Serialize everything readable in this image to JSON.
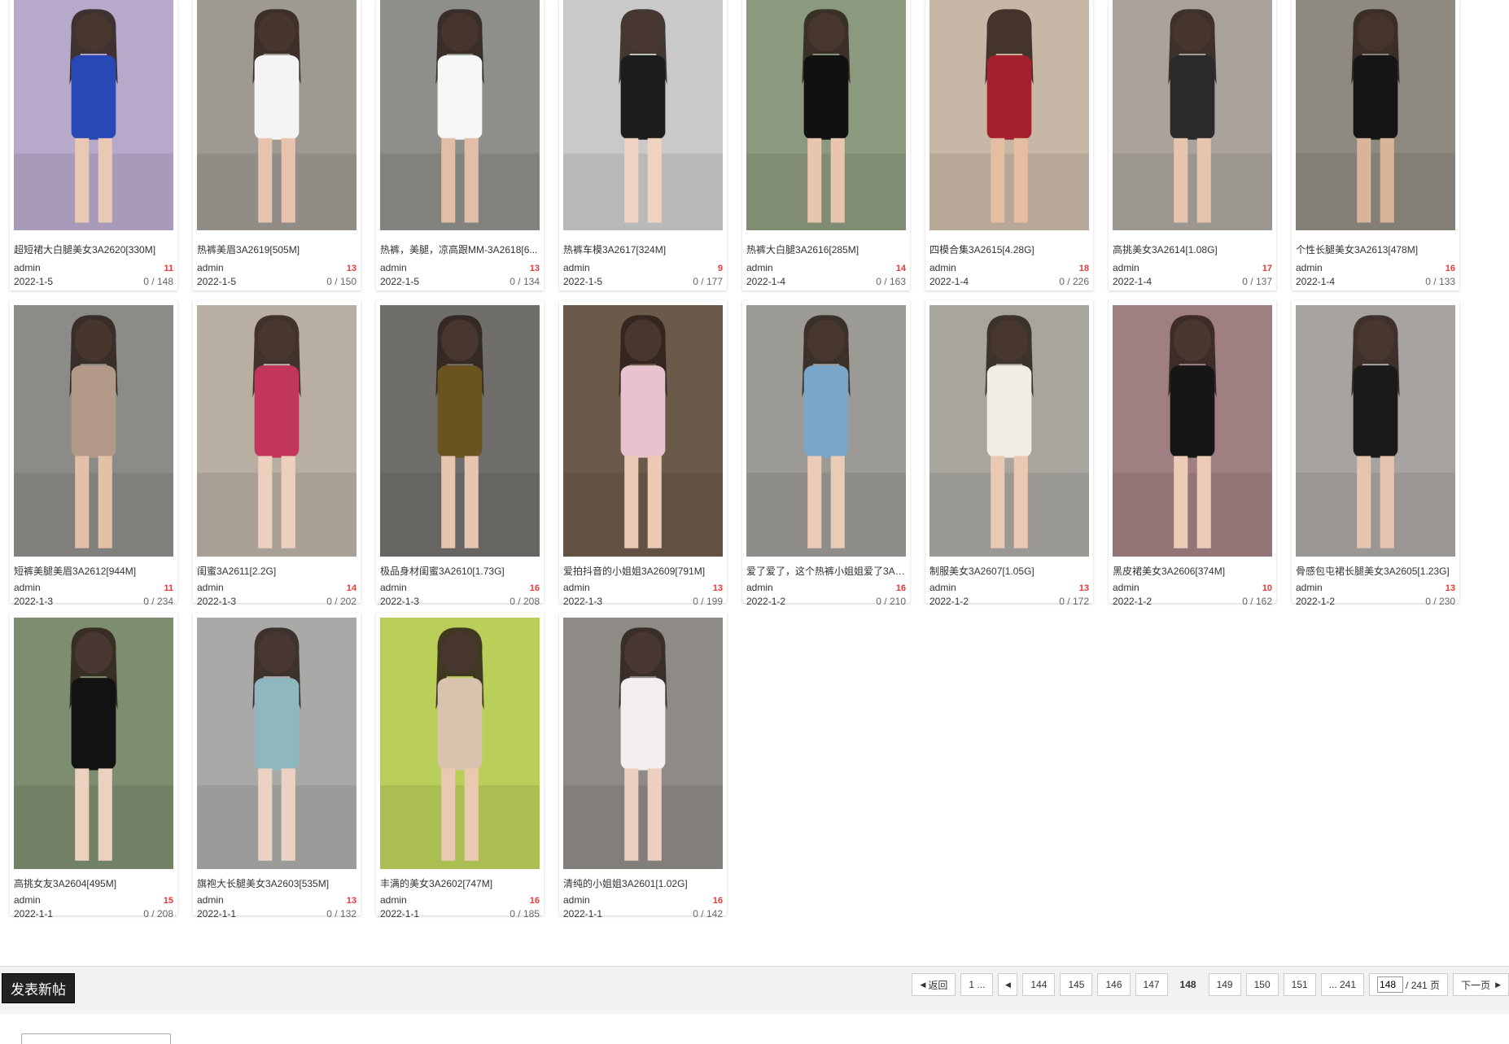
{
  "posts": [
    {
      "title": "超短裙大白腿美女3A2620[330M]",
      "author": "admin",
      "replies": "11",
      "date": "2022-1-5",
      "views": "0 / 148",
      "bg": "#b7a9c9",
      "fg": "#2748b5",
      "skin": "#e9c9b3"
    },
    {
      "title": "热裤美眉3A2619[505M]",
      "author": "admin",
      "replies": "13",
      "date": "2022-1-5",
      "views": "0 / 150",
      "bg": "#9e9a92",
      "fg": "#f4f4f4",
      "skin": "#e6c3ad"
    },
    {
      "title": "热裤，美腿，凉高跟MM-3A2618[6...",
      "author": "admin",
      "replies": "13",
      "date": "2022-1-5",
      "views": "0 / 134",
      "bg": "#8e8e8a",
      "fg": "#f6f6f6",
      "skin": "#e2bea6"
    },
    {
      "title": "热裤车模3A2617[324M]",
      "author": "admin",
      "replies": "9",
      "date": "2022-1-5",
      "views": "0 / 177",
      "bg": "#c9c9c9",
      "fg": "#1d1d1d",
      "skin": "#efd2c0"
    },
    {
      "title": "热裤大白腿3A2616[285M]",
      "author": "admin",
      "replies": "14",
      "date": "2022-1-4",
      "views": "0 / 163",
      "bg": "#8b9a7e",
      "fg": "#111111",
      "skin": "#e8c6ae"
    },
    {
      "title": "四模合集3A2615[4.28G]",
      "author": "admin",
      "replies": "18",
      "date": "2022-1-4",
      "views": "0 / 226",
      "bg": "#c8b7a6",
      "fg": "#a3202c",
      "skin": "#e5bda0"
    },
    {
      "title": "高挑美女3A2614[1.08G]",
      "author": "admin",
      "replies": "17",
      "date": "2022-1-4",
      "views": "0 / 137",
      "bg": "#a9a39c",
      "fg": "#2a2a2a",
      "skin": "#e6c4ae"
    },
    {
      "title": "个性长腿美女3A2613[478M]",
      "author": "admin",
      "replies": "16",
      "date": "2022-1-4",
      "views": "0 / 133",
      "bg": "#8f8a80",
      "fg": "#151515",
      "skin": "#d9b39a"
    },
    {
      "title": "短裤美腿美眉3A2612[944M]",
      "author": "admin",
      "replies": "11",
      "date": "2022-1-3",
      "views": "0 / 234",
      "bg": "#8b8c88",
      "fg": "#b39a88",
      "skin": "#e3c0a8"
    },
    {
      "title": "闺蜜3A2611[2.2G]",
      "author": "admin",
      "replies": "14",
      "date": "2022-1-3",
      "views": "0 / 202",
      "bg": "#b8aea2",
      "fg": "#c2365e",
      "skin": "#ecd0bd"
    },
    {
      "title": "极品身材闺蜜3A2610[1.73G]",
      "author": "admin",
      "replies": "16",
      "date": "2022-1-3",
      "views": "0 / 208",
      "bg": "#6f6e6a",
      "fg": "#6b5320",
      "skin": "#e7c6af"
    },
    {
      "title": "爱拍抖音的小姐姐3A2609[791M]",
      "author": "admin",
      "replies": "13",
      "date": "2022-1-3",
      "views": "0 / 199",
      "bg": "#6a5a4a",
      "fg": "#e8c3cf",
      "skin": "#ebcab5"
    },
    {
      "title": "爱了爱了，这个热裤小姐姐爱了3A2...",
      "author": "admin",
      "replies": "16",
      "date": "2022-1-2",
      "views": "0 / 210",
      "bg": "#9c9a95",
      "fg": "#7aa6c9",
      "skin": "#eacbb6"
    },
    {
      "title": "制服美女3A2607[1.05G]",
      "author": "admin",
      "replies": "13",
      "date": "2022-1-2",
      "views": "0 / 172",
      "bg": "#a8a59f",
      "fg": "#f0ede6",
      "skin": "#e9c9b2"
    },
    {
      "title": "黑皮裙美女3A2606[374M]",
      "author": "admin",
      "replies": "10",
      "date": "2022-1-2",
      "views": "0 / 162",
      "bg": "#a07f82",
      "fg": "#161616",
      "skin": "#ecccb7"
    },
    {
      "title": "骨感包屯裙长腿美女3A2605[1.23G]",
      "author": "admin",
      "replies": "13",
      "date": "2022-1-2",
      "views": "0 / 230",
      "bg": "#a6a3a0",
      "fg": "#1a1a1a",
      "skin": "#e6c5b0"
    },
    {
      "title": "高挑女友3A2604[495M]",
      "author": "admin",
      "replies": "15",
      "date": "2022-1-1",
      "views": "0 / 208",
      "bg": "#7c8e6f",
      "fg": "#121212",
      "skin": "#ecd1bf"
    },
    {
      "title": "旗袍大长腿美女3A2603[535M]",
      "author": "admin",
      "replies": "13",
      "date": "2022-1-1",
      "views": "0 / 132",
      "bg": "#a9aaa7",
      "fg": "#8fb7c0",
      "skin": "#ecd2c2"
    },
    {
      "title": "丰满的美女3A2602[747M]",
      "author": "admin",
      "replies": "16",
      "date": "2022-1-1",
      "views": "0 / 185",
      "bg": "#b9cf5a",
      "fg": "#d9c3ae",
      "skin": "#ebc9b1"
    },
    {
      "title": "清纯的小姐姐3A2601[1.02G]",
      "author": "admin",
      "replies": "16",
      "date": "2022-1-1",
      "views": "0 / 142",
      "bg": "#8e8a86",
      "fg": "#f3eeef",
      "skin": "#edcfc0"
    }
  ],
  "footer": {
    "post_button": "发表新帖",
    "pager": {
      "back": "返回",
      "first": "1 ...",
      "pages": [
        "144",
        "145",
        "146",
        "147",
        "148",
        "149",
        "150",
        "151"
      ],
      "current": "148",
      "last": "... 241",
      "input_value": "148",
      "total": "/ 241 页",
      "next": "下一页"
    }
  }
}
